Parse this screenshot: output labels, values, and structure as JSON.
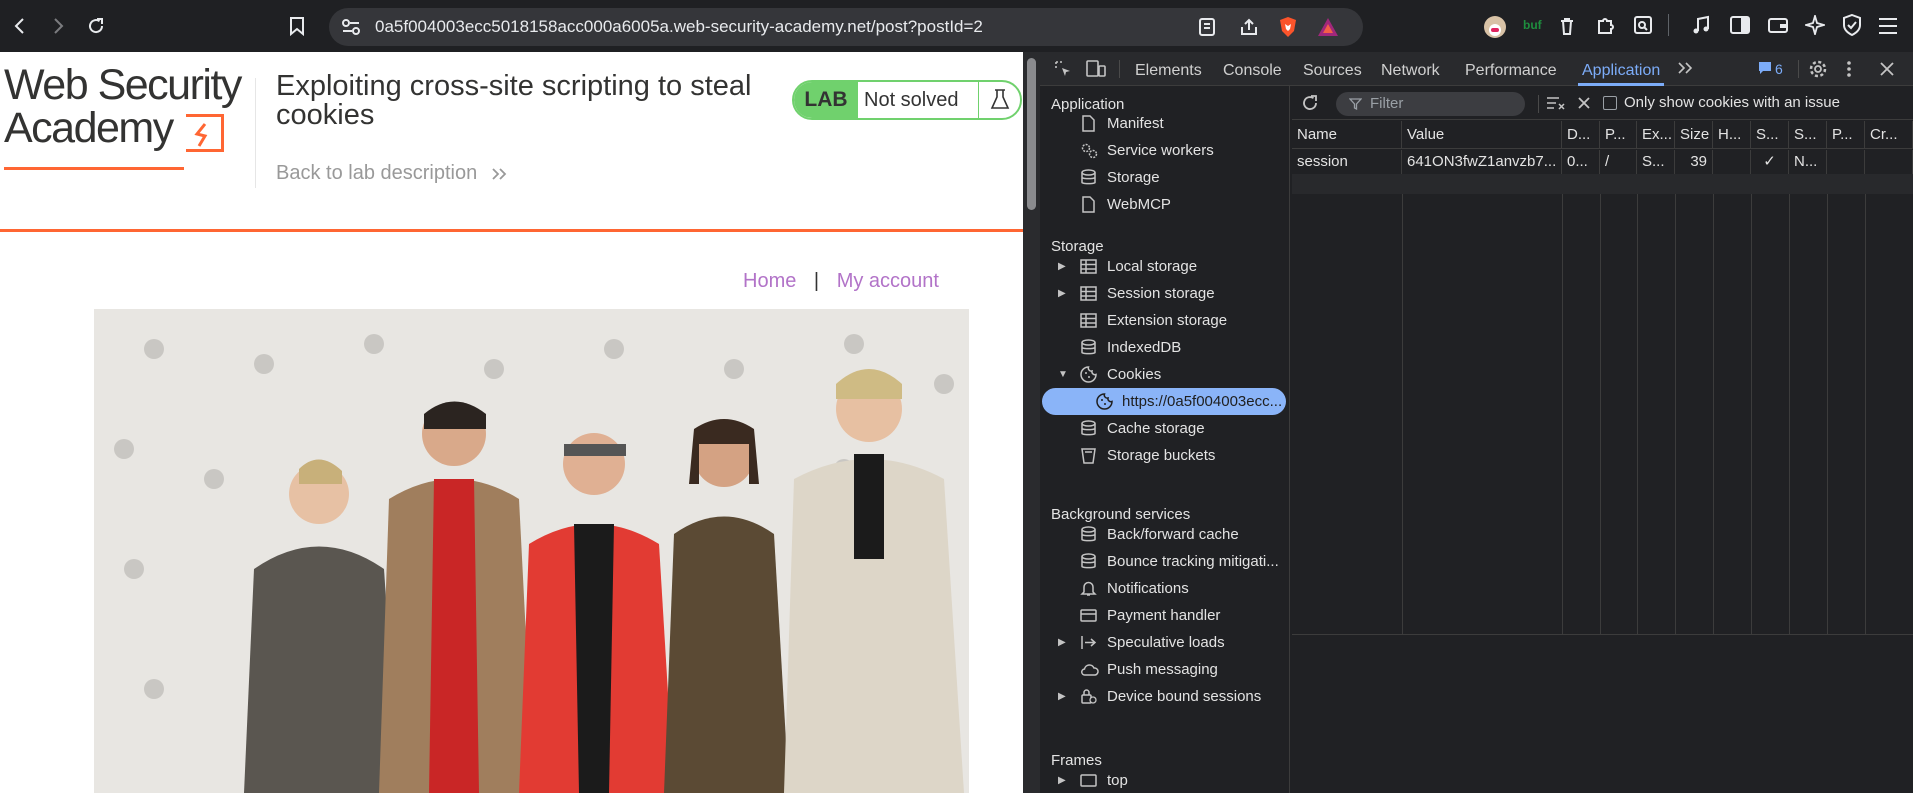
{
  "browser": {
    "url": "0a5f004003ecc5018158acc000a6005a.web-security-academy.net/post?postId=2",
    "extension_badge": "buf"
  },
  "page": {
    "logo_line1": "Web Security",
    "logo_line2": "Academy",
    "lab_title": "Exploiting cross-site scripting to steal cookies",
    "back_link": "Back to lab description",
    "lab_label": "LAB",
    "lab_status": "Not solved",
    "nav": {
      "home": "Home",
      "separator": "|",
      "account": "My account"
    },
    "accent_color": "#ff6633",
    "lab_color": "#70d16d",
    "link_color": "#b273c8"
  },
  "devtools": {
    "tabs": [
      "Elements",
      "Console",
      "Sources",
      "Network",
      "Performance",
      "Application"
    ],
    "active_tab": "Application",
    "issues_count": "6",
    "sidebar": {
      "application_header": "Application",
      "application_items": [
        "Manifest",
        "Service workers",
        "Storage",
        "WebMCP"
      ],
      "storage_header": "Storage",
      "storage_items": [
        "Local storage",
        "Session storage",
        "Extension storage",
        "IndexedDB",
        "Cookies",
        "https://0a5f004003ecc...",
        "Cache storage",
        "Storage buckets"
      ],
      "background_header": "Background services",
      "background_items": [
        "Back/forward cache",
        "Bounce tracking mitigati...",
        "Notifications",
        "Payment handler",
        "Speculative loads",
        "Push messaging",
        "Device bound sessions"
      ],
      "frames_header": "Frames",
      "frames_items": [
        "top"
      ]
    },
    "cookies": {
      "filter_placeholder": "Filter",
      "issue_checkbox_label": "Only show cookies with an issue",
      "columns": [
        "Name",
        "Value",
        "D...",
        "P...",
        "Ex...",
        "Size",
        "H...",
        "S...",
        "S...",
        "P...",
        "Cr..."
      ],
      "rows": [
        [
          "session",
          "641ON3fwZ1anvzb7...",
          "0...",
          "/",
          "S...",
          "39",
          "",
          "✓",
          "N...",
          "",
          ""
        ]
      ]
    }
  }
}
